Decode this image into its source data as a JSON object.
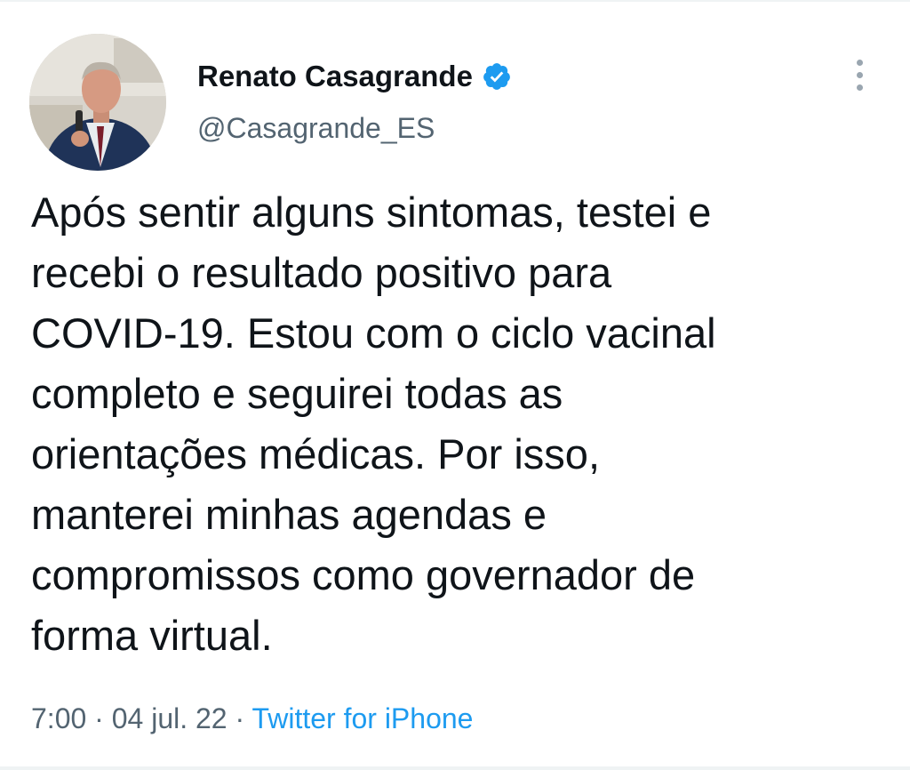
{
  "tweet": {
    "author": {
      "display_name": "Renato Casagrande",
      "handle": "@Casagrande_ES",
      "verified": true,
      "verified_color": "#1d9bf0"
    },
    "text": "Após sentir alguns sintomas, testei e\nrecebi o resultado positivo para\nCOVID-19. Estou com o ciclo vacinal\ncompleto e seguirei todas as\norientações médicas. Por isso,\nmanterei minhas agendas e\ncompromissos como governador de\nforma virtual.",
    "time": "7:00",
    "separator": "·",
    "date": "04 jul. 22",
    "source": "Twitter for iPhone"
  },
  "icons": {
    "verified": "verified-badge-icon",
    "more": "more-options-icon"
  }
}
